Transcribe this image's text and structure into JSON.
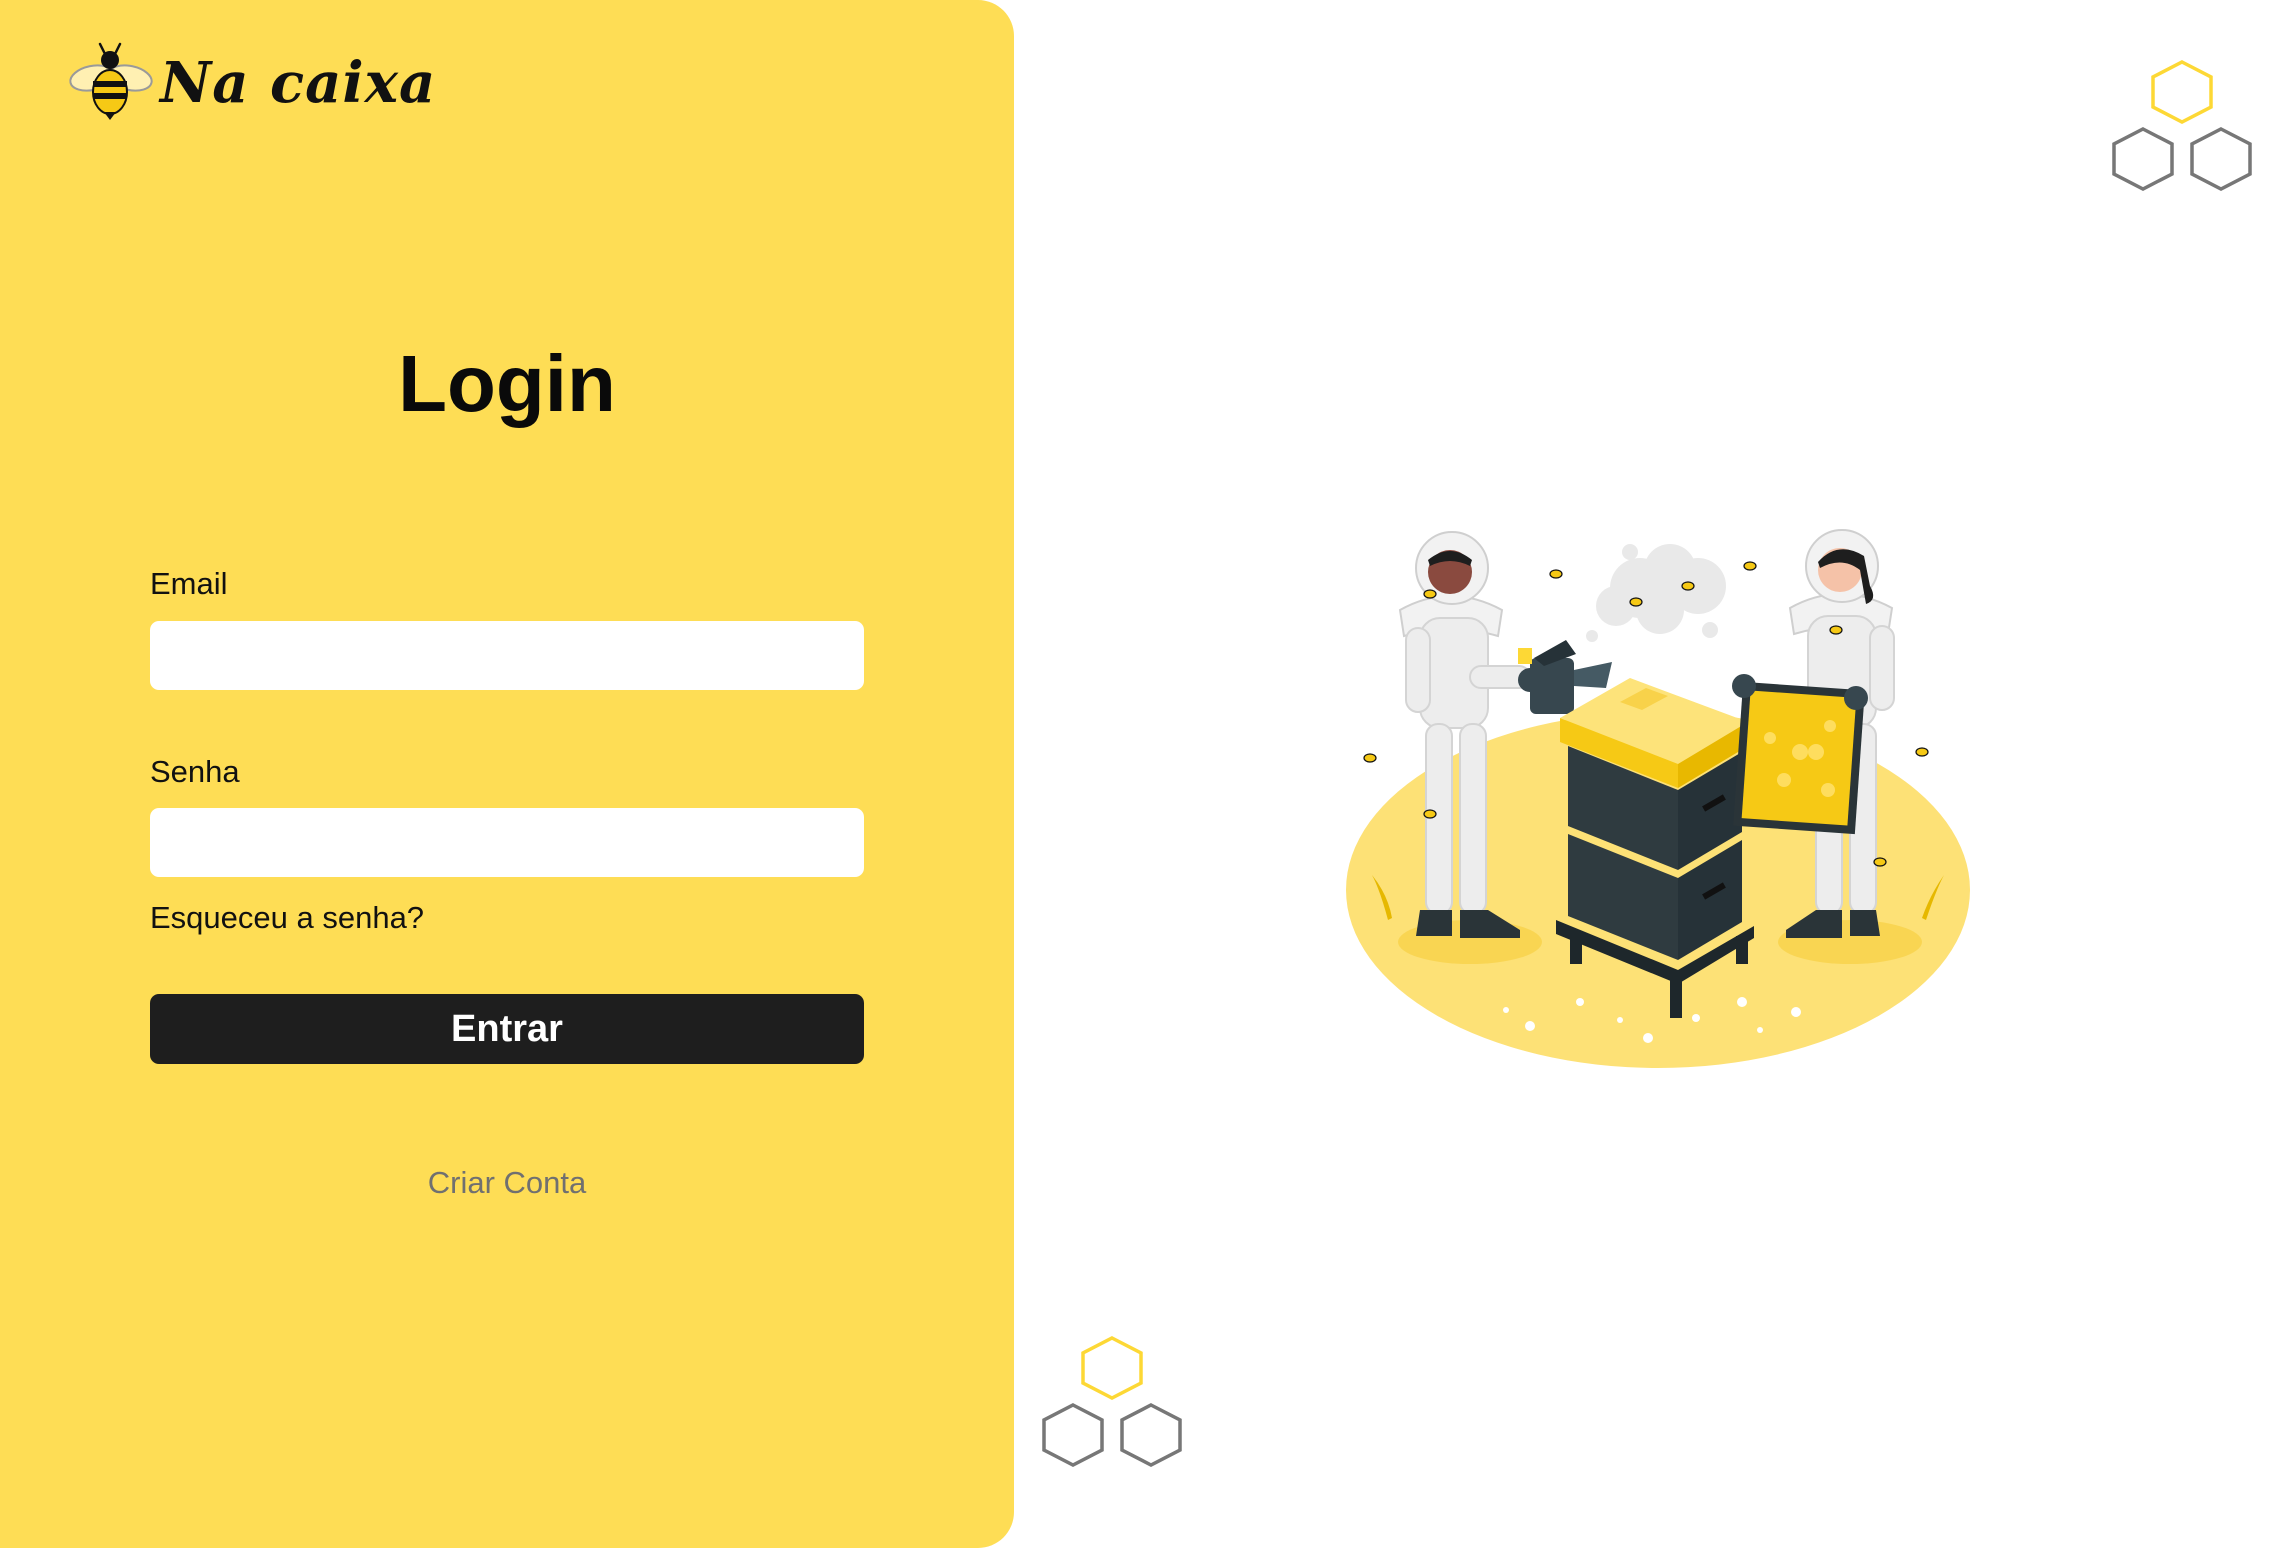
{
  "brand": {
    "name": "Na caixa",
    "logo_icon": "bee-icon"
  },
  "login": {
    "title": "Login",
    "email_label": "Email",
    "email_value": "",
    "password_label": "Senha",
    "password_value": "",
    "forgot_password": "Esqueceu a senha?",
    "submit_label": "Entrar",
    "create_account": "Criar Conta"
  },
  "decorations": {
    "honeycomb_icon": "honeycomb-icon",
    "illustration": "beekeepers-illustration"
  },
  "colors": {
    "panel_background": "#FEDD55",
    "button_background": "#1E1E1E",
    "accent_yellow": "#FDD835",
    "hexagon_gray": "#777777"
  }
}
